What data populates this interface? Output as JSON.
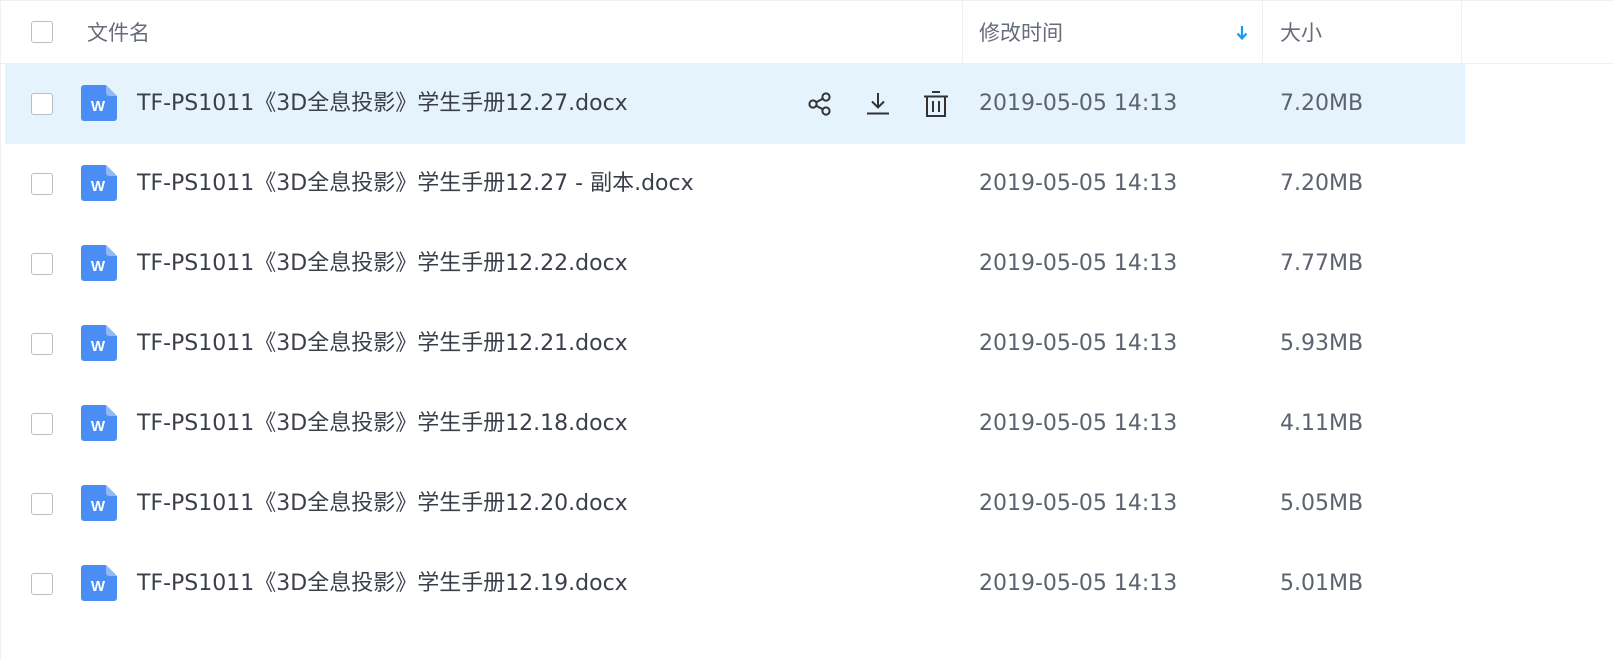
{
  "header": {
    "name_label": "文件名",
    "modified_label": "修改时间",
    "size_label": "大小",
    "sort": "descending-by-modified",
    "sort_color": "#1a9bf0"
  },
  "files": [
    {
      "name": "TF-PS1011《3D全息投影》学生手册12.27.docx",
      "modified": "2019-05-05 14:13",
      "size": "7.20MB",
      "icon": "word-doc-icon",
      "hover": true
    },
    {
      "name": "TF-PS1011《3D全息投影》学生手册12.27 - 副本.docx",
      "modified": "2019-05-05 14:13",
      "size": "7.20MB",
      "icon": "word-doc-icon",
      "hover": false
    },
    {
      "name": "TF-PS1011《3D全息投影》学生手册12.22.docx",
      "modified": "2019-05-05 14:13",
      "size": "7.77MB",
      "icon": "word-doc-icon",
      "hover": false
    },
    {
      "name": "TF-PS1011《3D全息投影》学生手册12.21.docx",
      "modified": "2019-05-05 14:13",
      "size": "5.93MB",
      "icon": "word-doc-icon",
      "hover": false
    },
    {
      "name": "TF-PS1011《3D全息投影》学生手册12.18.docx",
      "modified": "2019-05-05 14:13",
      "size": "4.11MB",
      "icon": "word-doc-icon",
      "hover": false
    },
    {
      "name": "TF-PS1011《3D全息投影》学生手册12.20.docx",
      "modified": "2019-05-05 14:13",
      "size": "5.05MB",
      "icon": "word-doc-icon",
      "hover": false
    },
    {
      "name": "TF-PS1011《3D全息投影》学生手册12.19.docx",
      "modified": "2019-05-05 14:13",
      "size": "5.01MB",
      "icon": "word-doc-icon",
      "hover": false
    }
  ],
  "row_actions": [
    "share-icon",
    "download-icon",
    "delete-icon"
  ],
  "colors": {
    "hover_row": "#e5f3fd",
    "word_icon": "#4a8ef5",
    "text": "#3a3f4a"
  }
}
